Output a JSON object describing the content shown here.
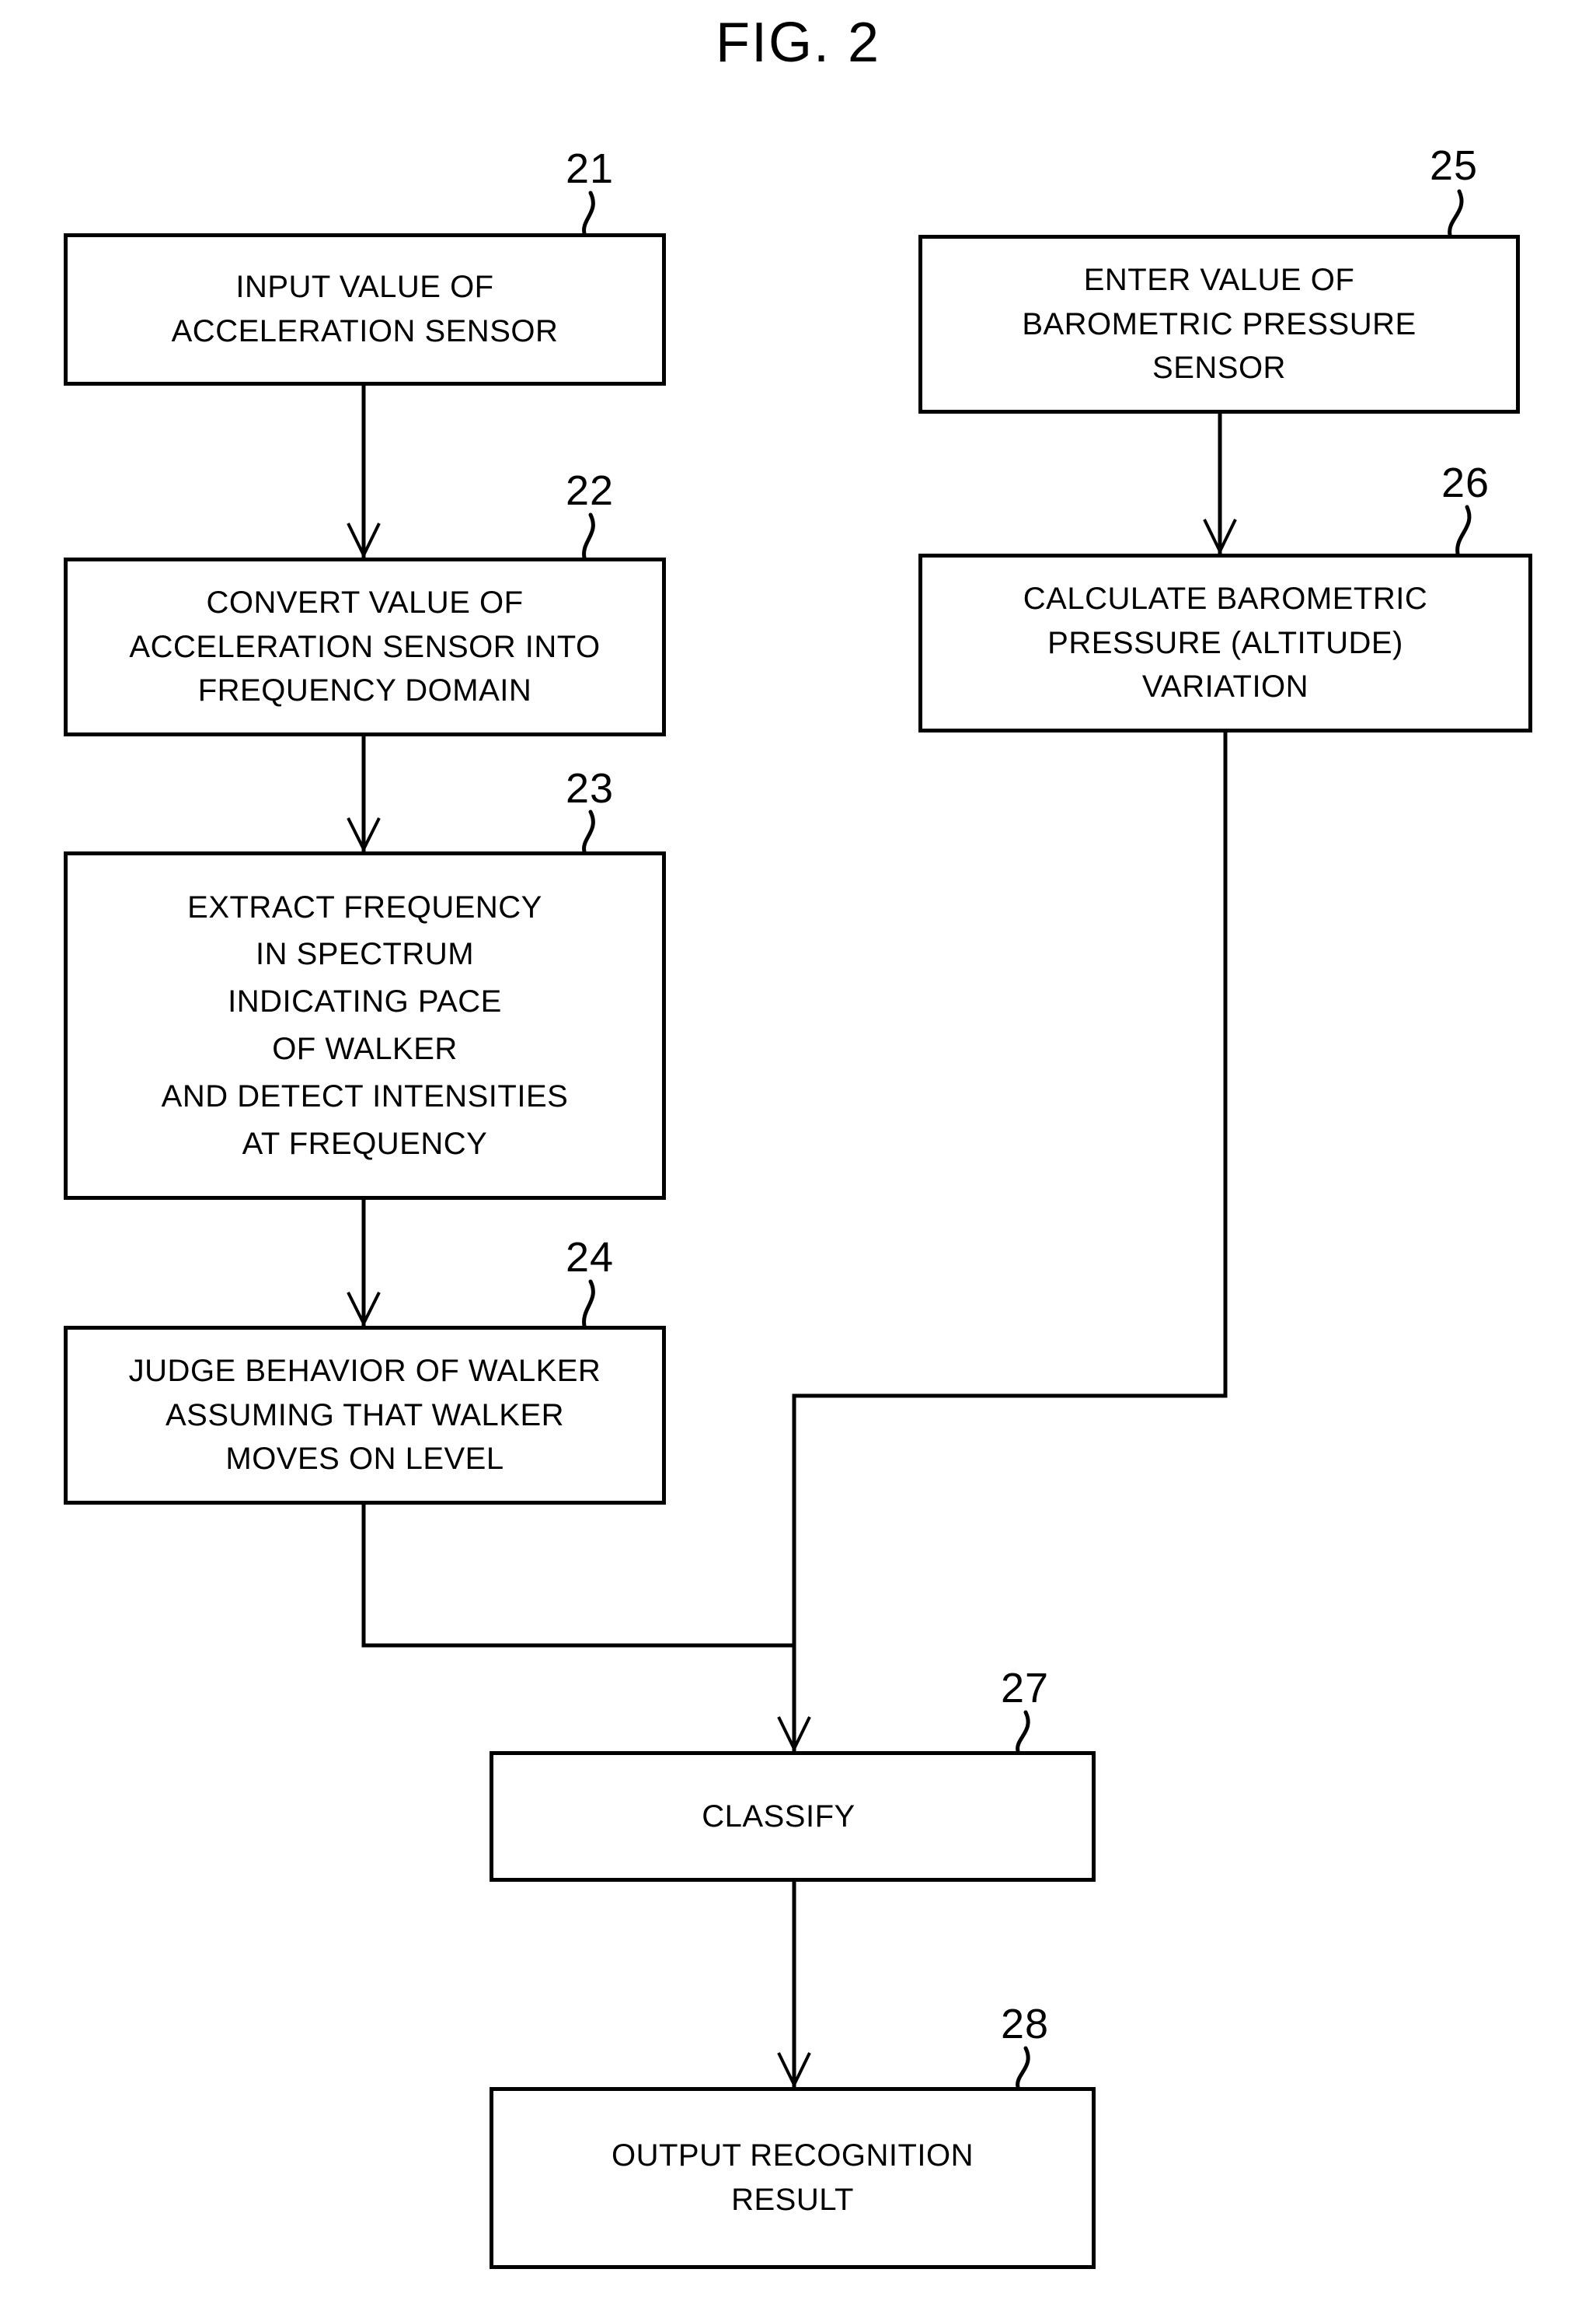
{
  "figure": {
    "title": "FIG. 2",
    "domain": "patent-flowchart"
  },
  "nodes": [
    {
      "ref": "21",
      "name": "input-acceleration-sensor",
      "text": "INPUT VALUE OF\nACCELERATION SENSOR"
    },
    {
      "ref": "22",
      "name": "convert-to-frequency-domain",
      "text": "CONVERT VALUE OF\nACCELERATION SENSOR INTO\nFREQUENCY DOMAIN"
    },
    {
      "ref": "23",
      "name": "extract-frequency-spectrum",
      "text": "EXTRACT FREQUENCY\nIN SPECTRUM\nINDICATING PACE\nOF WALKER\nAND DETECT INTENSITIES\nAT FREQUENCY"
    },
    {
      "ref": "24",
      "name": "judge-behavior-of-walker",
      "text": "JUDGE BEHAVIOR OF WALKER\nASSUMING THAT WALKER\nMOVES ON LEVEL"
    },
    {
      "ref": "25",
      "name": "enter-barometric-pressure",
      "text": "ENTER VALUE OF\nBAROMETRIC PRESSURE\nSENSOR"
    },
    {
      "ref": "26",
      "name": "calculate-pressure-variation",
      "text": "CALCULATE BAROMETRIC\nPRESSURE (ALTITUDE)\nVARIATION"
    },
    {
      "ref": "27",
      "name": "classify",
      "text": "CLASSIFY"
    },
    {
      "ref": "28",
      "name": "output-recognition-result",
      "text": "OUTPUT RECOGNITION\nRESULT"
    }
  ],
  "reference_numerals": {
    "n21": "21",
    "n22": "22",
    "n23": "23",
    "n24": "24",
    "n25": "25",
    "n26": "26",
    "n27": "27",
    "n28": "28"
  },
  "connections": [
    {
      "from": "21",
      "to": "22",
      "name": "arrow-21-to-22",
      "style": "vertical-arrow"
    },
    {
      "from": "22",
      "to": "23",
      "name": "arrow-22-to-23",
      "style": "vertical-arrow"
    },
    {
      "from": "23",
      "to": "24",
      "name": "arrow-23-to-24",
      "style": "vertical-arrow"
    },
    {
      "from": "24",
      "to": "27",
      "name": "path-24-to-27",
      "style": "down-right-elbow"
    },
    {
      "from": "25",
      "to": "26",
      "name": "arrow-25-to-26",
      "style": "vertical-arrow"
    },
    {
      "from": "26",
      "to": "27",
      "name": "path-26-to-27",
      "style": "down-left-down-arrow"
    },
    {
      "from": "27",
      "to": "28",
      "name": "arrow-27-to-28",
      "style": "vertical-arrow"
    }
  ],
  "colors": {
    "ink": "#000000",
    "paper": "#ffffff"
  }
}
